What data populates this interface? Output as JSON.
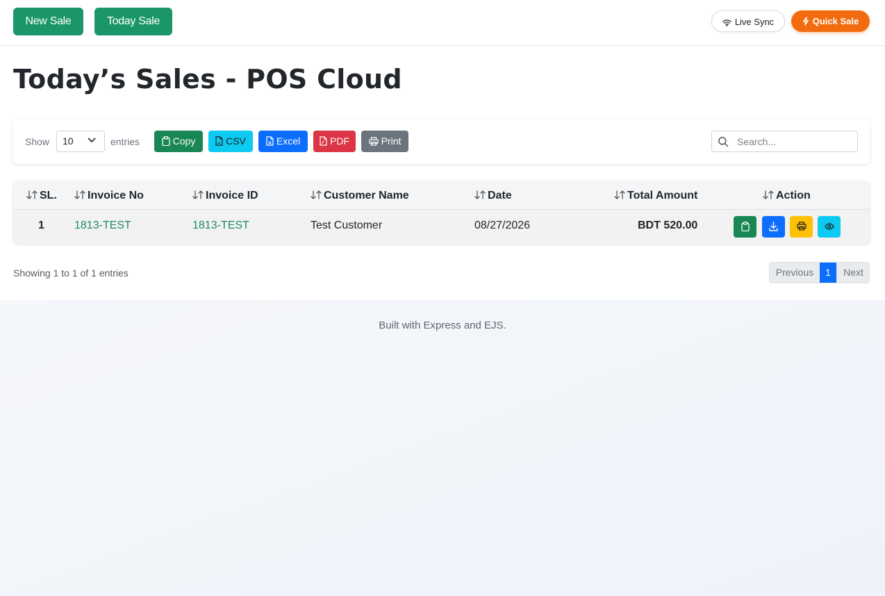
{
  "topbar": {
    "new_sale_label": "New Sale",
    "today_sale_label": "Today Sale",
    "live_sync_label": "Live Sync",
    "quick_sale_label": "Quick Sale"
  },
  "page": {
    "title": "Today’s Sales - POS Cloud"
  },
  "toolbar": {
    "show_label": "Show",
    "entries_label": "entries",
    "page_length": "10",
    "export_buttons": {
      "copy": "Copy",
      "csv": "CSV",
      "excel": "Excel",
      "pdf": "PDF",
      "print": "Print"
    },
    "search_placeholder": "Search..."
  },
  "table": {
    "columns": [
      "SL.",
      "Invoice No",
      "Invoice ID",
      "Customer Name",
      "Date",
      "Total Amount",
      "Action"
    ],
    "rows": [
      {
        "sl": "1",
        "invoice_no": "1813-TEST",
        "invoice_id": "1813-TEST",
        "customer_name": "Test Customer",
        "date": "08/27/2026",
        "total_amount": "BDT 520.00"
      }
    ]
  },
  "pagination": {
    "info": "Showing 1 to 1 of 1 entries",
    "previous": "Previous",
    "current_page": "1",
    "next": "Next"
  },
  "footer": {
    "text": "Built with Express and EJS."
  },
  "icons": {
    "live_sync": "wifi-icon",
    "quick_sale": "lightning-icon",
    "copy": "clipboard-icon",
    "csv": "file-csv-icon",
    "excel": "file-excel-icon",
    "pdf": "file-pdf-icon",
    "print": "printer-icon",
    "search": "search-icon",
    "sort": "sort-arrows-icon",
    "row_actions": [
      "clipboard-icon",
      "download-icon",
      "printer-icon",
      "eye-icon"
    ]
  },
  "colors": {
    "primary_green": "#1a9668",
    "quick_sale_orange": "#f26c0f",
    "copy": "#198754",
    "csv": "#0dcaf0",
    "excel": "#0d6efd",
    "pdf": "#dc3545",
    "print": "#6c757d",
    "action_view": "#198754",
    "action_download": "#0d6efd",
    "action_print": "#ffc107",
    "action_eye": "#0dcaf0",
    "link": "#1f8a5f",
    "active_page": "#0d6efd"
  }
}
